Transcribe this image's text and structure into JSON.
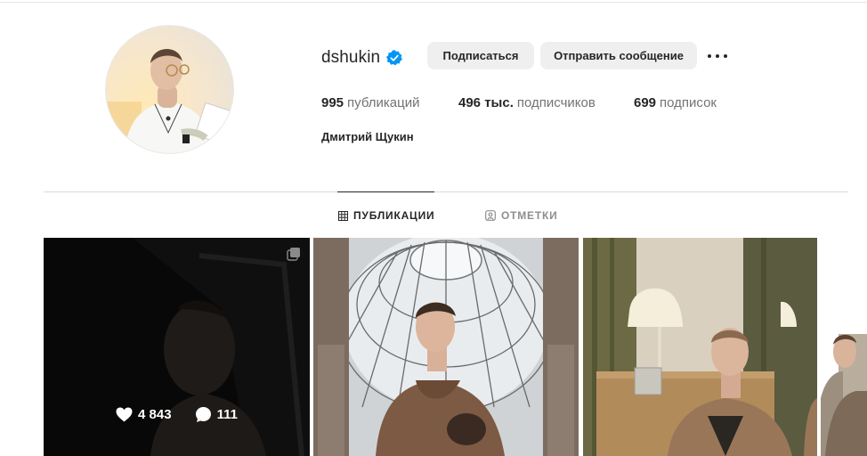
{
  "profile": {
    "username": "dshukin",
    "full_name": "Дмитрий Щукин",
    "verified_icon": "verified-badge-icon",
    "accent_color": "#0095f6"
  },
  "actions": {
    "follow_label": "Подписаться",
    "message_label": "Отправить сообщение",
    "more_icon": "more-options-icon"
  },
  "stats": {
    "posts_count": "995",
    "posts_label": "публикаций",
    "followers_count": "496 тыс.",
    "followers_label": "подписчиков",
    "following_count": "699",
    "following_label": "подписок"
  },
  "tabs": [
    {
      "label": "ПУБЛИКАЦИИ",
      "icon": "grid-icon",
      "active": true
    },
    {
      "label": "ОТМЕТКИ",
      "icon": "tagged-icon",
      "active": false
    }
  ],
  "posts": [
    {
      "likes": "4 843",
      "comments": "111",
      "multi": true,
      "hovered": true
    },
    {
      "likes": "",
      "comments": "",
      "multi": false,
      "hovered": false
    },
    {
      "likes": "",
      "comments": "",
      "multi": false,
      "hovered": false
    }
  ]
}
